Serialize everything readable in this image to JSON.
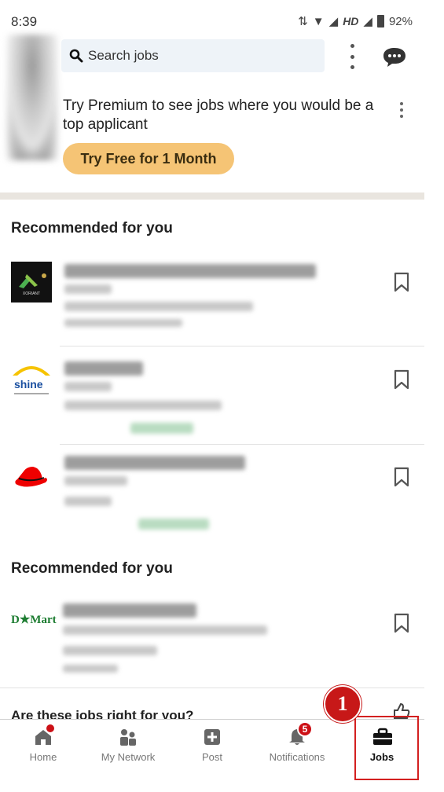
{
  "status_bar": {
    "time": "8:39",
    "network": "HD",
    "battery": "92%"
  },
  "search": {
    "placeholder": "Search jobs"
  },
  "premium": {
    "text": "Try Premium to see jobs where you would be a top applicant",
    "button": "Try Free for 1 Month"
  },
  "sections": [
    {
      "title": "Recommended for you"
    },
    {
      "title": "Recommended for you"
    }
  ],
  "jobs": [
    {
      "logo": "xoriant-logo",
      "logo_text": "XORIANT"
    },
    {
      "logo": "shine-logo",
      "logo_text": "shine"
    },
    {
      "logo": "redhat-logo",
      "logo_text": ""
    },
    {
      "logo": "dmart-logo",
      "logo_text": "D★Mart"
    }
  ],
  "feedback": {
    "question": "Are these jobs right for you?"
  },
  "bottom_nav": {
    "items": [
      {
        "label": "Home",
        "icon": "home-icon"
      },
      {
        "label": "My Network",
        "icon": "network-icon"
      },
      {
        "label": "Post",
        "icon": "post-icon"
      },
      {
        "label": "Notifications",
        "icon": "bell-icon",
        "badge": "5"
      },
      {
        "label": "Jobs",
        "icon": "briefcase-icon",
        "active": true
      }
    ]
  },
  "annotation": {
    "number": "1"
  },
  "colors": {
    "premium_button": "#f5c475",
    "badge": "#cc1016",
    "highlight": "#d32020",
    "search_bg": "#eef3f8"
  }
}
